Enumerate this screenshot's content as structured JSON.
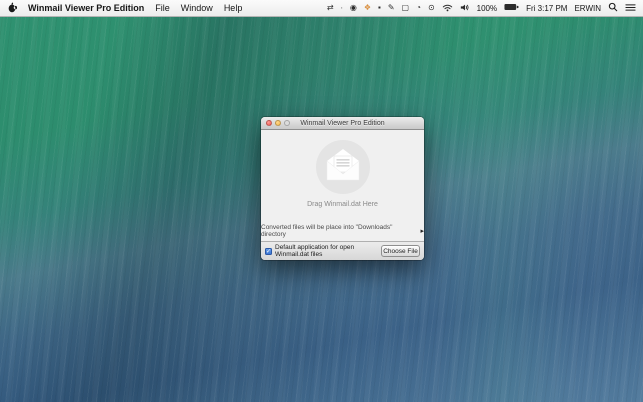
{
  "menu_bar": {
    "app_name": "Winmail Viewer Pro Edition",
    "menus": [
      "File",
      "Window",
      "Help"
    ],
    "status_icons": [
      {
        "name": "sync-icon",
        "glyph": "⇄"
      },
      {
        "name": "dot-icon",
        "glyph": "∙"
      },
      {
        "name": "record-icon",
        "glyph": "◉"
      },
      {
        "name": "app-color-icon",
        "glyph": "❖"
      },
      {
        "name": "box-icon",
        "glyph": "▪"
      },
      {
        "name": "pen-icon",
        "glyph": "✎"
      },
      {
        "name": "display-icon",
        "glyph": "▢"
      },
      {
        "name": "clock-pie-icon",
        "glyph": "◔"
      },
      {
        "name": "target-icon",
        "glyph": "⊙"
      }
    ],
    "battery_percent": "100%",
    "clock": "Fri 3:17 PM",
    "user_name": "ERWIN"
  },
  "window": {
    "title": "Winmail Viewer Pro Edition",
    "drop_label": "Drag Winmail.dat Here",
    "info_text": "Converted files will be place into \"Downloads\" directory",
    "disclosure": "▸",
    "checkbox_label": "Default application for open Winmail.dat files",
    "checkbox_checked": true,
    "checkbox_glyph": "✓",
    "choose_file_button": "Choose File"
  },
  "colors": {
    "wallpaper_green": "#2e8f6e",
    "wallpaper_teal": "#4a7a8a",
    "wallpaper_blue": "#34597f",
    "menu_bar_bg": "#f4f4f4",
    "checkbox_blue": "#3a76d6",
    "close_button_red": "#f25a52",
    "minimize_button_yellow": "#f6b74c",
    "zoom_button_disabled": "#dcdcdc",
    "drop_circle_gray": "#e4e4e4"
  }
}
